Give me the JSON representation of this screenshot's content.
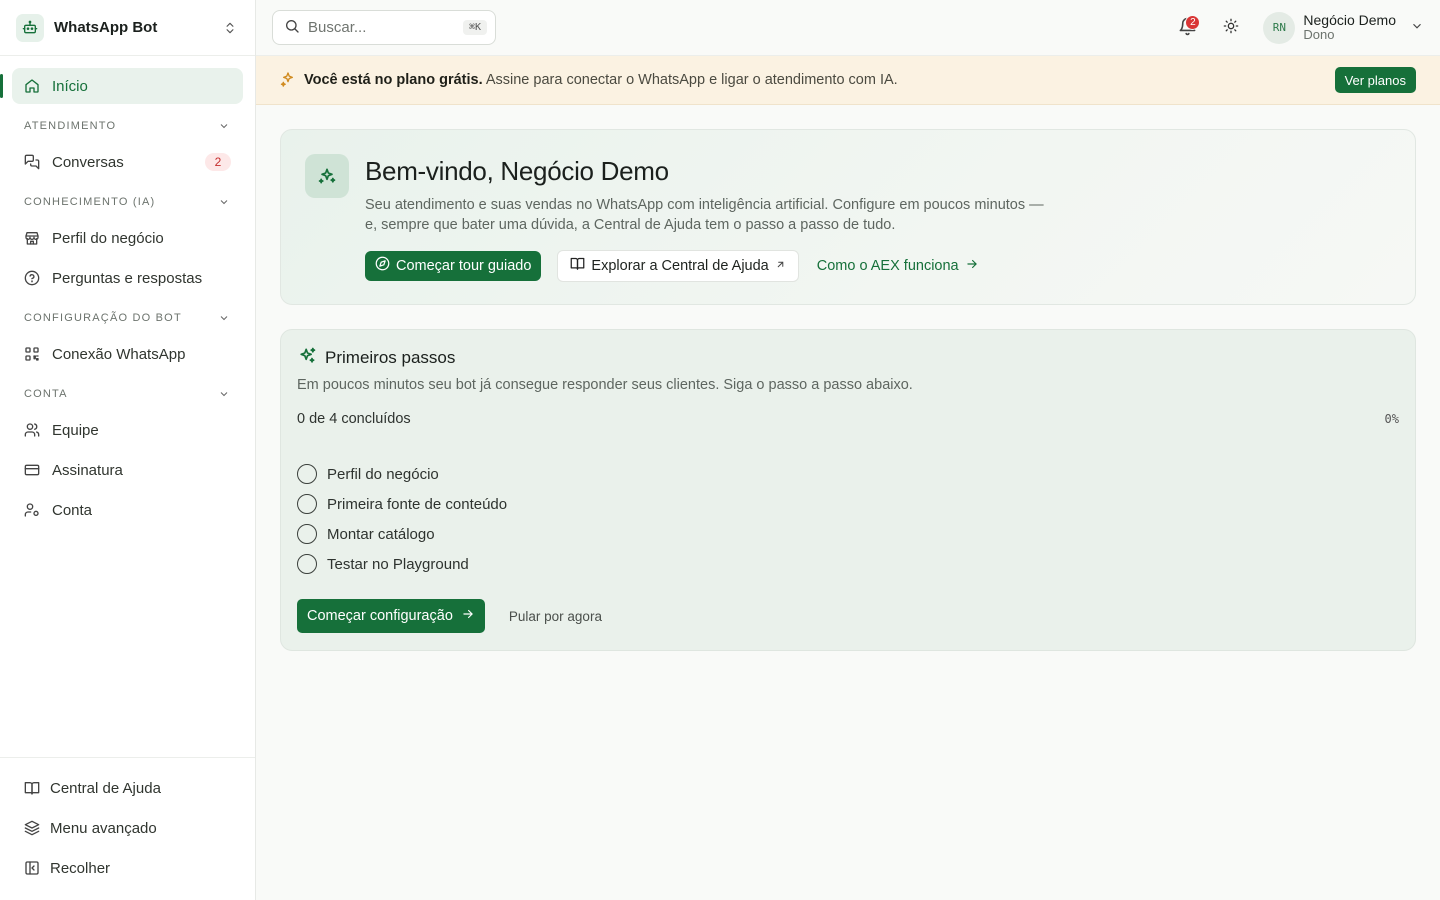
{
  "brand": {
    "name": "WhatsApp Bot"
  },
  "sidebar": {
    "home": {
      "label": "Início"
    },
    "sections": [
      {
        "title": "ATENDIMENTO",
        "items": [
          {
            "label": "Conversas",
            "badge": "2"
          }
        ]
      },
      {
        "title": "CONHECIMENTO (IA)",
        "items": [
          {
            "label": "Perfil do negócio"
          },
          {
            "label": "Perguntas e respostas"
          }
        ]
      },
      {
        "title": "CONFIGURAÇÃO DO BOT",
        "items": [
          {
            "label": "Conexão WhatsApp"
          }
        ]
      },
      {
        "title": "CONTA",
        "items": [
          {
            "label": "Equipe"
          },
          {
            "label": "Assinatura"
          },
          {
            "label": "Conta"
          }
        ]
      }
    ],
    "footer": [
      {
        "label": "Central de Ajuda"
      },
      {
        "label": "Menu avançado"
      },
      {
        "label": "Recolher"
      }
    ]
  },
  "topbar": {
    "search_placeholder": "Buscar...",
    "shortcut": "⌘K",
    "notifications_count": "2",
    "user": {
      "initials": "RN",
      "name": "Negócio Demo",
      "role": "Dono"
    }
  },
  "banner": {
    "bold": "Você está no plano grátis.",
    "text": " Assine para conectar o WhatsApp e ligar o atendimento com IA.",
    "button": "Ver planos"
  },
  "welcome": {
    "title": "Bem-vindo, Negócio Demo",
    "description": "Seu atendimento e suas vendas no WhatsApp com inteligência artificial. Configure em poucos minutos — e, sempre que bater uma dúvida, a Central de Ajuda tem o passo a passo de tudo.",
    "tour_button": "Começar tour guiado",
    "help_button": "Explorar a Central de Ajuda",
    "how_link": "Como o AEX funciona"
  },
  "steps": {
    "title": "Primeiros passos",
    "subtitle": "Em poucos minutos seu bot já consegue responder seus clientes. Siga o passo a passo abaixo.",
    "progress_label": "0 de 4 concluídos",
    "progress_pct": "0%",
    "progress_value": 0,
    "items": [
      {
        "label": "Perfil do negócio"
      },
      {
        "label": "Primeira fonte de conteúdo"
      },
      {
        "label": "Montar catálogo"
      },
      {
        "label": "Testar no Playground"
      }
    ],
    "start_button": "Começar configuração",
    "skip": "Pular por agora"
  },
  "colors": {
    "accent": "#16703a",
    "banner_bg": "#fbf2e2",
    "badge_red": "#d93636"
  },
  "icons": {
    "brand": "bot-icon",
    "switch": "chevrons-up-down-icon",
    "home": "home-icon",
    "conversations": "chat-icon",
    "profile": "store-icon",
    "faq": "help-circle-icon",
    "whatsapp": "qr-code-icon",
    "team": "users-icon",
    "billing": "credit-card-icon",
    "account": "user-cog-icon",
    "help": "book-icon",
    "advanced": "layers-icon",
    "collapse": "panel-left-icon",
    "search": "search-icon",
    "bell": "bell-icon",
    "theme": "sun-icon",
    "sparkles": "sparkles-icon",
    "compass": "compass-icon",
    "external": "arrow-up-right-icon",
    "arrow": "arrow-right-icon"
  }
}
